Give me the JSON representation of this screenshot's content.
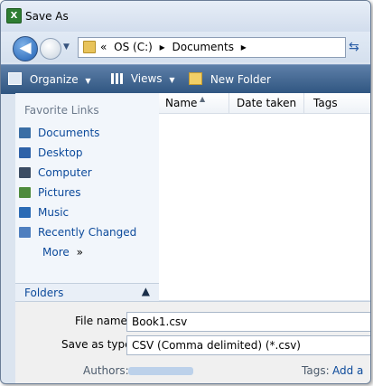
{
  "window": {
    "title": "Save As",
    "app_icon": "X"
  },
  "address": {
    "crumbs": [
      "«",
      "OS (C:)",
      "▸",
      "Documents",
      "▸"
    ]
  },
  "toolbar": {
    "organize": "Organize",
    "views": "Views",
    "new_folder": "New Folder",
    "dropdown_glyph": "▼"
  },
  "favorites": {
    "heading": "Favorite Links",
    "items": [
      {
        "label": "Documents",
        "icon": "documents-icon",
        "color": "#3a6ea5"
      },
      {
        "label": "Desktop",
        "icon": "desktop-icon",
        "color": "#2e62a8"
      },
      {
        "label": "Computer",
        "icon": "computer-icon",
        "color": "#3b4c63"
      },
      {
        "label": "Pictures",
        "icon": "pictures-icon",
        "color": "#4e8b3d"
      },
      {
        "label": "Music",
        "icon": "music-icon",
        "color": "#2b6bb5"
      },
      {
        "label": "Recently Changed",
        "icon": "recent-icon",
        "color": "#4f7fbf"
      }
    ],
    "more": "More",
    "more_glyph": "»"
  },
  "folders": {
    "label": "Folders",
    "chevron": "▲"
  },
  "columns": [
    "Name",
    "Date taken",
    "Tags"
  ],
  "form": {
    "file_name_label": "File name:",
    "file_name_value": "Book1.csv",
    "save_type_label": "Save as type:",
    "save_type_value": "CSV (Comma delimited) (*.csv)",
    "authors_label": "Authors:",
    "tags_label": "Tags:",
    "tags_value": "Add a"
  },
  "colors": {
    "link": "#0c4a9b",
    "toolbar": "#3a6290"
  }
}
